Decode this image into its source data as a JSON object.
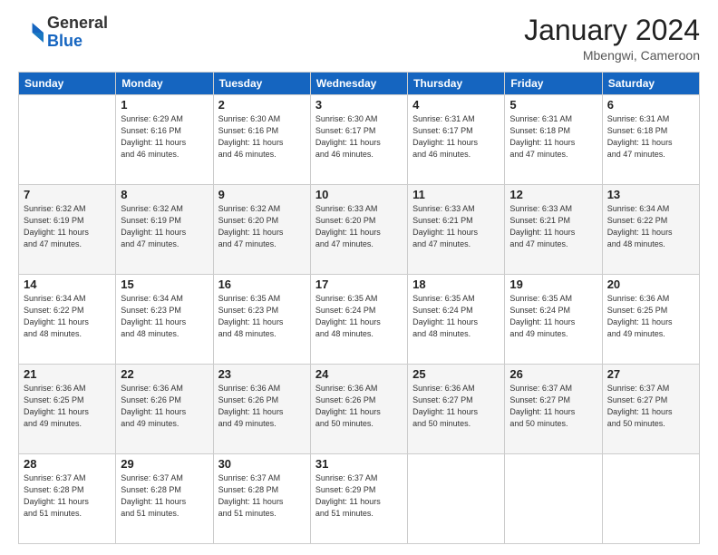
{
  "header": {
    "logo_general": "General",
    "logo_blue": "Blue",
    "month_title": "January 2024",
    "location": "Mbengwi, Cameroon"
  },
  "weekdays": [
    "Sunday",
    "Monday",
    "Tuesday",
    "Wednesday",
    "Thursday",
    "Friday",
    "Saturday"
  ],
  "weeks": [
    [
      {
        "day": "",
        "info": ""
      },
      {
        "day": "1",
        "info": "Sunrise: 6:29 AM\nSunset: 6:16 PM\nDaylight: 11 hours\nand 46 minutes."
      },
      {
        "day": "2",
        "info": "Sunrise: 6:30 AM\nSunset: 6:16 PM\nDaylight: 11 hours\nand 46 minutes."
      },
      {
        "day": "3",
        "info": "Sunrise: 6:30 AM\nSunset: 6:17 PM\nDaylight: 11 hours\nand 46 minutes."
      },
      {
        "day": "4",
        "info": "Sunrise: 6:31 AM\nSunset: 6:17 PM\nDaylight: 11 hours\nand 46 minutes."
      },
      {
        "day": "5",
        "info": "Sunrise: 6:31 AM\nSunset: 6:18 PM\nDaylight: 11 hours\nand 47 minutes."
      },
      {
        "day": "6",
        "info": "Sunrise: 6:31 AM\nSunset: 6:18 PM\nDaylight: 11 hours\nand 47 minutes."
      }
    ],
    [
      {
        "day": "7",
        "info": "Sunrise: 6:32 AM\nSunset: 6:19 PM\nDaylight: 11 hours\nand 47 minutes."
      },
      {
        "day": "8",
        "info": "Sunrise: 6:32 AM\nSunset: 6:19 PM\nDaylight: 11 hours\nand 47 minutes."
      },
      {
        "day": "9",
        "info": "Sunrise: 6:32 AM\nSunset: 6:20 PM\nDaylight: 11 hours\nand 47 minutes."
      },
      {
        "day": "10",
        "info": "Sunrise: 6:33 AM\nSunset: 6:20 PM\nDaylight: 11 hours\nand 47 minutes."
      },
      {
        "day": "11",
        "info": "Sunrise: 6:33 AM\nSunset: 6:21 PM\nDaylight: 11 hours\nand 47 minutes."
      },
      {
        "day": "12",
        "info": "Sunrise: 6:33 AM\nSunset: 6:21 PM\nDaylight: 11 hours\nand 47 minutes."
      },
      {
        "day": "13",
        "info": "Sunrise: 6:34 AM\nSunset: 6:22 PM\nDaylight: 11 hours\nand 48 minutes."
      }
    ],
    [
      {
        "day": "14",
        "info": "Sunrise: 6:34 AM\nSunset: 6:22 PM\nDaylight: 11 hours\nand 48 minutes."
      },
      {
        "day": "15",
        "info": "Sunrise: 6:34 AM\nSunset: 6:23 PM\nDaylight: 11 hours\nand 48 minutes."
      },
      {
        "day": "16",
        "info": "Sunrise: 6:35 AM\nSunset: 6:23 PM\nDaylight: 11 hours\nand 48 minutes."
      },
      {
        "day": "17",
        "info": "Sunrise: 6:35 AM\nSunset: 6:24 PM\nDaylight: 11 hours\nand 48 minutes."
      },
      {
        "day": "18",
        "info": "Sunrise: 6:35 AM\nSunset: 6:24 PM\nDaylight: 11 hours\nand 48 minutes."
      },
      {
        "day": "19",
        "info": "Sunrise: 6:35 AM\nSunset: 6:24 PM\nDaylight: 11 hours\nand 49 minutes."
      },
      {
        "day": "20",
        "info": "Sunrise: 6:36 AM\nSunset: 6:25 PM\nDaylight: 11 hours\nand 49 minutes."
      }
    ],
    [
      {
        "day": "21",
        "info": "Sunrise: 6:36 AM\nSunset: 6:25 PM\nDaylight: 11 hours\nand 49 minutes."
      },
      {
        "day": "22",
        "info": "Sunrise: 6:36 AM\nSunset: 6:26 PM\nDaylight: 11 hours\nand 49 minutes."
      },
      {
        "day": "23",
        "info": "Sunrise: 6:36 AM\nSunset: 6:26 PM\nDaylight: 11 hours\nand 49 minutes."
      },
      {
        "day": "24",
        "info": "Sunrise: 6:36 AM\nSunset: 6:26 PM\nDaylight: 11 hours\nand 50 minutes."
      },
      {
        "day": "25",
        "info": "Sunrise: 6:36 AM\nSunset: 6:27 PM\nDaylight: 11 hours\nand 50 minutes."
      },
      {
        "day": "26",
        "info": "Sunrise: 6:37 AM\nSunset: 6:27 PM\nDaylight: 11 hours\nand 50 minutes."
      },
      {
        "day": "27",
        "info": "Sunrise: 6:37 AM\nSunset: 6:27 PM\nDaylight: 11 hours\nand 50 minutes."
      }
    ],
    [
      {
        "day": "28",
        "info": "Sunrise: 6:37 AM\nSunset: 6:28 PM\nDaylight: 11 hours\nand 51 minutes."
      },
      {
        "day": "29",
        "info": "Sunrise: 6:37 AM\nSunset: 6:28 PM\nDaylight: 11 hours\nand 51 minutes."
      },
      {
        "day": "30",
        "info": "Sunrise: 6:37 AM\nSunset: 6:28 PM\nDaylight: 11 hours\nand 51 minutes."
      },
      {
        "day": "31",
        "info": "Sunrise: 6:37 AM\nSunset: 6:29 PM\nDaylight: 11 hours\nand 51 minutes."
      },
      {
        "day": "",
        "info": ""
      },
      {
        "day": "",
        "info": ""
      },
      {
        "day": "",
        "info": ""
      }
    ]
  ]
}
